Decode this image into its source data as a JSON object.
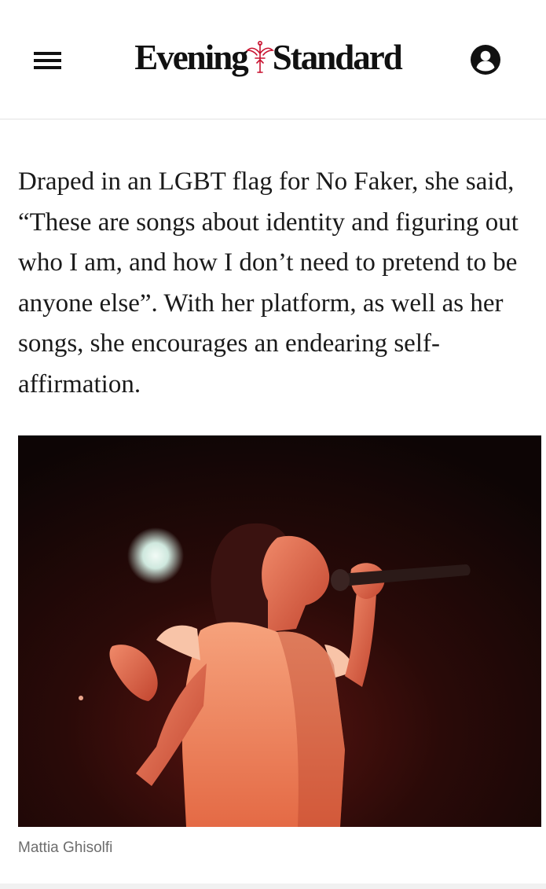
{
  "header": {
    "menu_icon": "hamburger-menu-icon",
    "masthead_left": "Evening",
    "masthead_right": "Standard",
    "account_icon": "account-user-icon",
    "brand_color": "#111111",
    "emblem_color": "#c8102e"
  },
  "article": {
    "paragraph": "Draped in an LGBT flag for No Faker, she said, “These are songs about identity and figuring out who I am, and how I don’t need to pretend to be anyone else”. With her platform, as well as her songs, she encourages an endearing self-affirmation."
  },
  "image": {
    "caption": "Mattia Ghisolfi"
  }
}
